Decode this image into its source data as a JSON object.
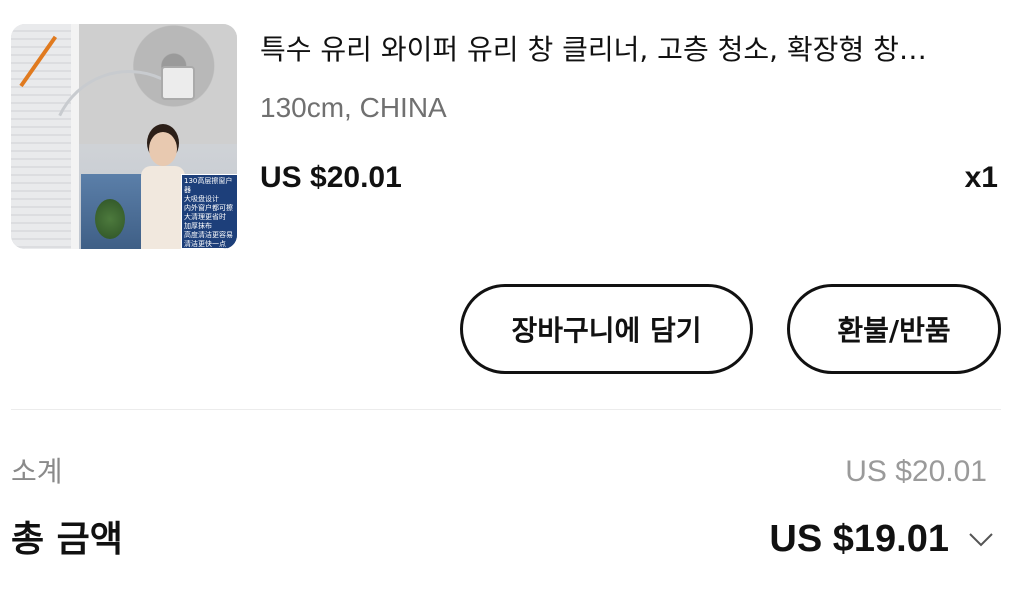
{
  "product": {
    "title": "특수 유리 와이퍼 유리 창 클리너, 고층 청소, 확장형 창…",
    "variant": "130cm, CHINA",
    "price": "US $20.01",
    "quantity": "x1",
    "image_panel_text": [
      "130高层擦窗户器",
      "大吸盘设计",
      "内外窗户都可擦",
      "大清理更省时",
      "加厚抹布",
      "高度清洁更容易",
      "清洁更快一点"
    ]
  },
  "actions": {
    "add_to_cart": "장바구니에 담기",
    "refund": "환불/반품"
  },
  "summary": {
    "subtotal_label": "소계",
    "subtotal_value": "US $20.01",
    "total_label": "총 금액",
    "total_value": "US $19.01"
  },
  "icons": {
    "expand": "chevron-down-icon"
  }
}
